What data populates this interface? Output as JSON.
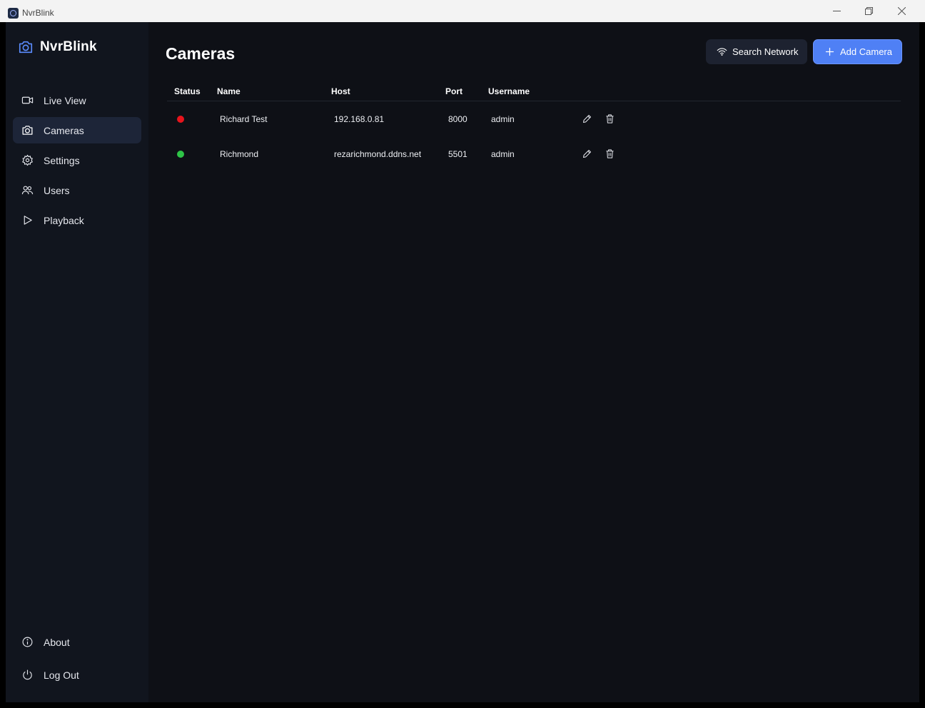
{
  "window": {
    "title": "NvrBlink"
  },
  "sidebar": {
    "brand": "NvrBlink",
    "items": [
      {
        "label": "Live View",
        "icon": "video-icon"
      },
      {
        "label": "Cameras",
        "icon": "camera-icon",
        "active": true
      },
      {
        "label": "Settings",
        "icon": "gear-icon"
      },
      {
        "label": "Users",
        "icon": "users-icon"
      },
      {
        "label": "Playback",
        "icon": "play-icon"
      }
    ],
    "bottom": [
      {
        "label": "About",
        "icon": "info-icon"
      },
      {
        "label": "Log Out",
        "icon": "power-icon"
      }
    ]
  },
  "main": {
    "title": "Cameras",
    "search_label": "Search Network",
    "add_label": "Add Camera",
    "columns": [
      "Status",
      "Name",
      "Host",
      "Port",
      "Username"
    ],
    "rows": [
      {
        "status": "offline",
        "status_color": "#e8141c",
        "name": "Richard Test",
        "host": "192.168.0.81",
        "port": "8000",
        "username": "admin"
      },
      {
        "status": "online",
        "status_color": "#2ec447",
        "name": "Richmond",
        "host": "rezarichmond.ddns.net",
        "port": "5501",
        "username": "admin"
      }
    ]
  },
  "colors": {
    "accent": "#4f80f5",
    "sidebar_bg": "#11151e",
    "main_bg": "#0e1016",
    "active_item": "#1d2538"
  }
}
